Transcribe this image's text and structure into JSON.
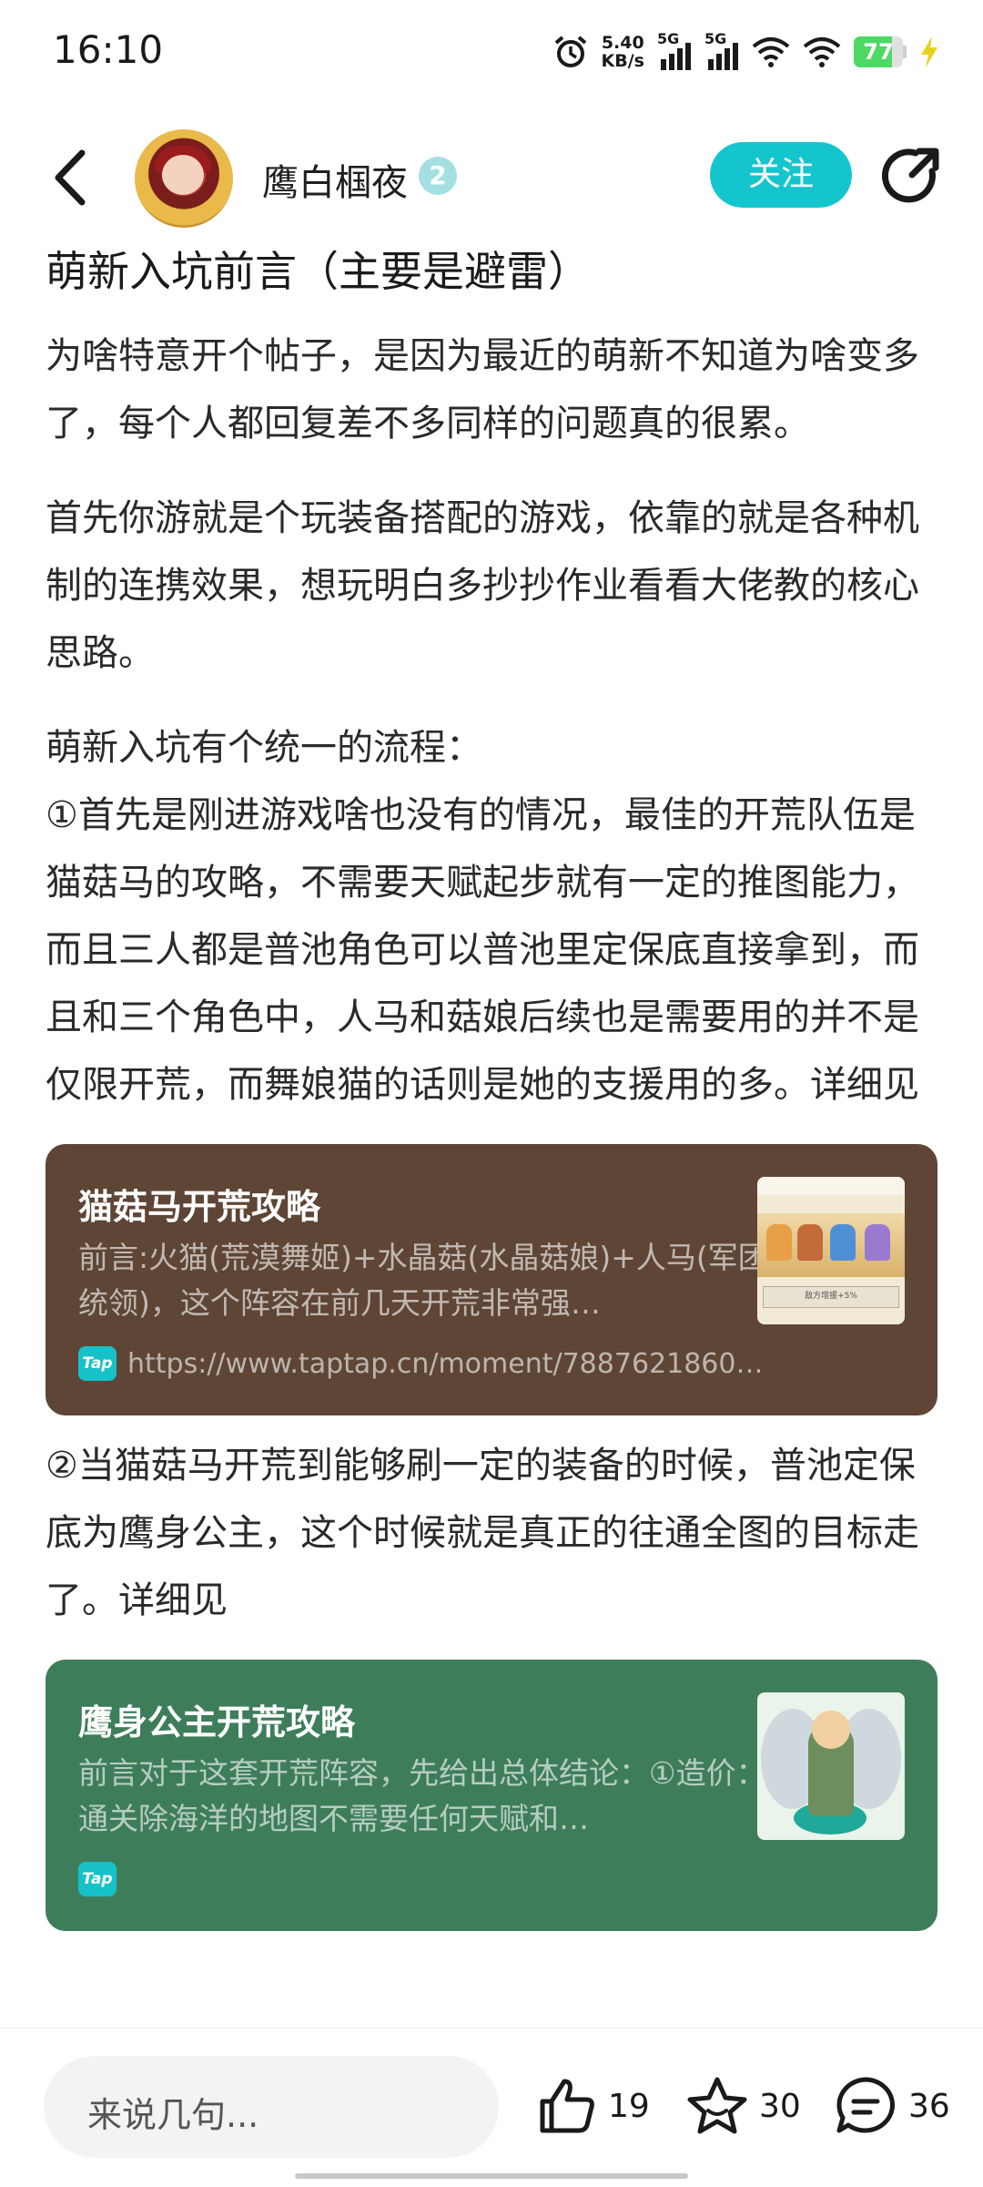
{
  "status_bar": {
    "time": "16:10",
    "net_speed_value": "5.40",
    "net_speed_unit": "KB/s",
    "signal1_label": "5G",
    "signal2_label": "5G",
    "battery": "77",
    "battery_level": 0.77
  },
  "header": {
    "author_name": "鹰白椢夜",
    "level": "2",
    "follow_label": "关注"
  },
  "post": {
    "title": "萌新入坑前言（主要是避雷）",
    "p1": "为啥特意开个帖子，是因为最近的萌新不知道为啥变多了，每个人都回复差不多同样的问题真的很累。",
    "p2": "首先你游就是个玩装备搭配的游戏，依靠的就是各种机制的连携效果，想玩明白多抄抄作业看看大佬教的核心思路。",
    "p3a": "萌新入坑有个统一的流程：",
    "p3b": "①首先是刚进游戏啥也没有的情况，最佳的开荒队伍是猫菇马的攻略，不需要天赋起步就有一定的推图能力，而且三人都是普池角色可以普池里定保底直接拿到，而且和三个角色中，人马和菇娘后续也是需要用的并不是仅限开荒，而舞娘猫的话则是她的支援用的多。详细见",
    "card1": {
      "title": "猫菇马开荒攻略",
      "desc": "前言:火猫(荒漠舞姬)+水晶菇(水晶菇娘)+人马(军团统领)，这个阵容在前几天开荒非常强…",
      "tap_label": "Tap",
      "url": "https://www.taptap.cn/moment/7887621860…",
      "thumb_caption": "敌方增援+5%"
    },
    "p4": "②当猫菇马开荒到能够刷一定的装备的时候，普池定保底为鹰身公主，这个时候就是真正的往通全图的目标走了。详细见",
    "card2": {
      "title": "鹰身公主开荒攻略",
      "desc": "前言对于这套开荒阵容，先给出总体结论：①造价：通关除海洋的地图不需要任何天赋和…",
      "tap_label": "Tap"
    }
  },
  "bottom_bar": {
    "comment_placeholder": "来说几句...",
    "like_count": "19",
    "favorite_count": "30",
    "comment_count": "36"
  }
}
